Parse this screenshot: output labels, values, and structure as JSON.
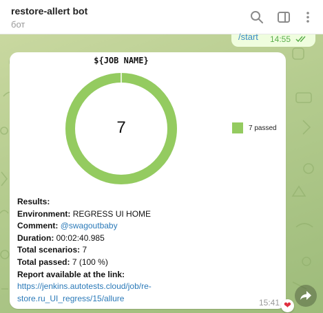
{
  "header": {
    "title": "restore-allert bot",
    "subtitle": "бот",
    "icons": [
      "search-icon",
      "sidebar-toggle-icon",
      "more-vertical-icon"
    ]
  },
  "sent_message": {
    "text": "/start",
    "time": "14:55",
    "status": "double-check-icon"
  },
  "message": {
    "chart_data": {
      "type": "pie",
      "title": "${JOB NAME}",
      "center_label": "7",
      "categories": [
        "passed"
      ],
      "values": [
        7
      ],
      "colors": [
        "#94cb60"
      ],
      "legend": [
        "7 passed"
      ],
      "legend_position": "right",
      "donut": true
    },
    "results": {
      "heading": "Results:",
      "environment_label": "Environment:",
      "environment_value": "REGRESS UI HOME",
      "comment_label": "Comment:",
      "comment_value": "@swagoutbaby",
      "duration_label": "Duration:",
      "duration_value": "00:02:40.985",
      "total_scenarios_label": "Total scenarios:",
      "total_scenarios_value": "7",
      "total_passed_label": "Total passed:",
      "total_passed_value": "7 (100 %)",
      "report_label": "Report available at the link:",
      "report_link_line1": "https://jenkins.autotests.cloud/job/re-",
      "report_link_line2": "store.ru_UI_regress/15/allure"
    },
    "time": "15:41",
    "reaction": "❤"
  },
  "colors": {
    "accent": "#3a8ac7",
    "link": "#2a79b8",
    "chart_green": "#94cb60",
    "sent_bubble": "#effdde",
    "time_green": "#5bae4c"
  }
}
